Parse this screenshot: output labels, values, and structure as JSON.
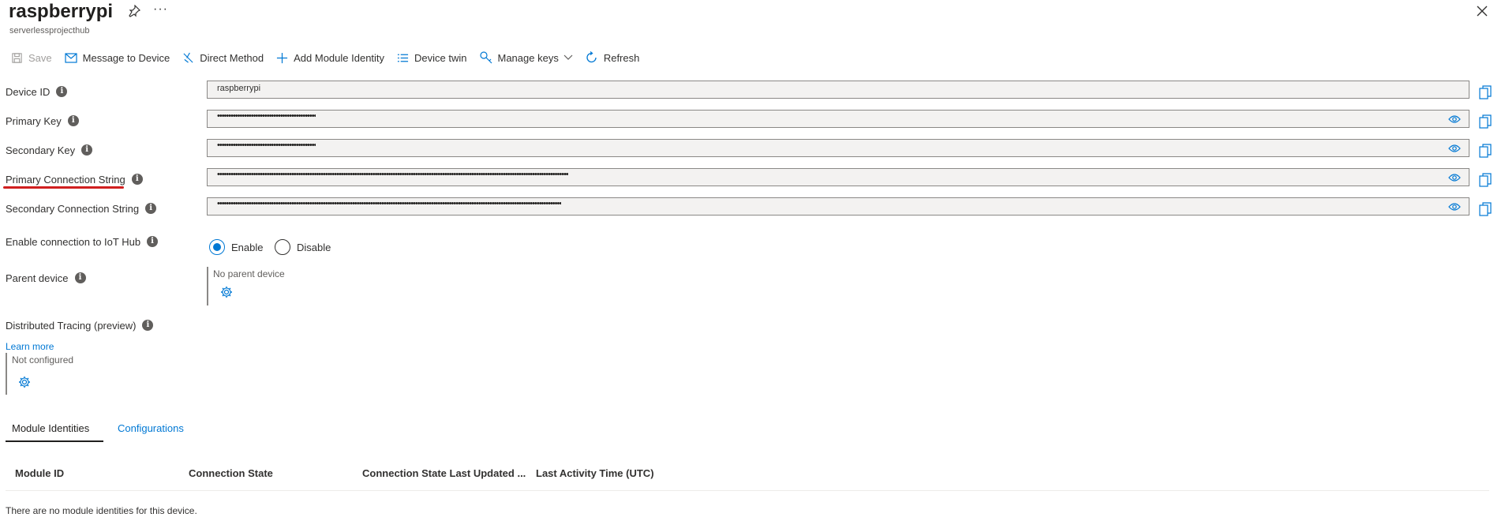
{
  "header": {
    "title": "raspberrypi",
    "subtitle": "serverlessprojecthub",
    "more": "···"
  },
  "toolbar": {
    "save": "Save",
    "message": "Message to Device",
    "direct_method": "Direct Method",
    "add_module": "Add Module Identity",
    "device_twin": "Device twin",
    "manage_keys": "Manage keys",
    "refresh": "Refresh"
  },
  "form": {
    "device_id": {
      "label": "Device ID",
      "value": "raspberrypi"
    },
    "primary_key": {
      "label": "Primary Key",
      "value": "••••••••••••••••••••••••••••••••••••••••••••"
    },
    "secondary_key": {
      "label": "Secondary Key",
      "value": "••••••••••••••••••••••••••••••••••••••••••••"
    },
    "primary_conn": {
      "label": "Primary Connection String",
      "value": "••••••••••••••••••••••••••••••••••••••••••••••••••••••••••••••••••••••••••••••••••••••••••••••••••••••••••••••••••••••••••••••••••••••••••••••••••••••••••••"
    },
    "secondary_conn": {
      "label": "Secondary Connection String",
      "value": "•••••••••••••••••••••••••••••••••••••••••••••••••••••••••••••••••••••••••••••••••••••••••••••••••••••••••••••••••••••••••••••••••••••••••••••••••••••••••"
    },
    "enable_conn": {
      "label": "Enable connection to IoT Hub",
      "enable": "Enable",
      "disable": "Disable"
    },
    "parent_device": {
      "label": "Parent device",
      "value": "No parent device"
    },
    "tracing": {
      "label": "Distributed Tracing (preview)",
      "learn_more": "Learn more",
      "value": "Not configured"
    },
    "info_glyph": "i"
  },
  "tabs": {
    "modules": "Module Identities",
    "configurations": "Configurations"
  },
  "table": {
    "columns": [
      "Module ID",
      "Connection State",
      "Connection State Last Updated ...",
      "Last Activity Time (UTC)"
    ],
    "empty": "There are no module identities for this device."
  },
  "colors": {
    "accent": "#0078d4",
    "highlight": "#d01f1f"
  }
}
